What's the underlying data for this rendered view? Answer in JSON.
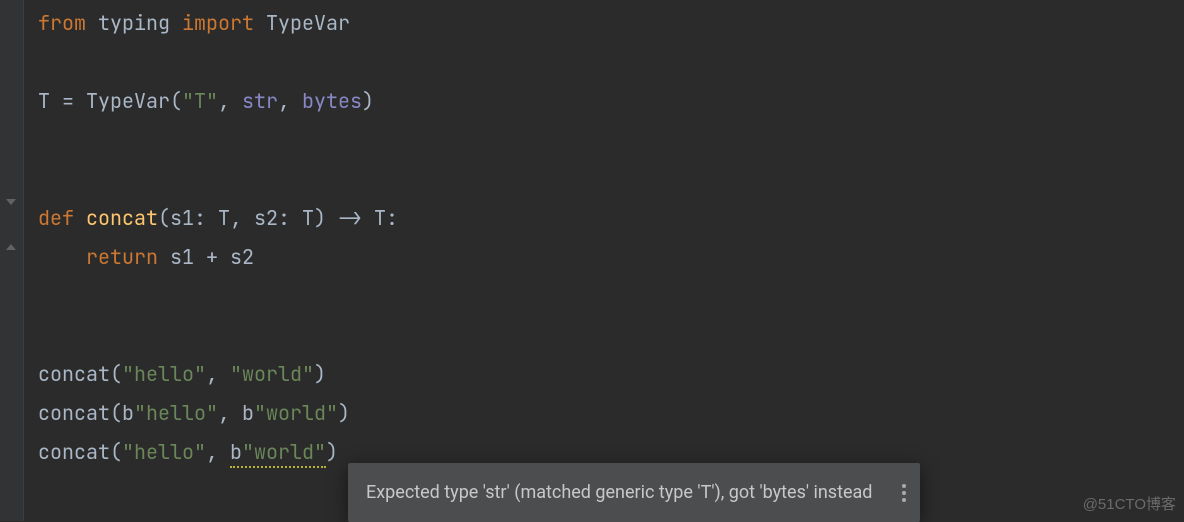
{
  "code": {
    "line1": {
      "kw1": "from",
      "mod": "typing",
      "kw2": "import",
      "name": "TypeVar"
    },
    "line3": {
      "var": "T",
      "eq": " = ",
      "ctor": "TypeVar",
      "lp": "(",
      "strT": "\"T\"",
      "c1": ", ",
      "a1": "str",
      "c2": ", ",
      "a2": "bytes",
      "rp": ")"
    },
    "line6": {
      "kw": "def",
      "fn": "concat",
      "lp": "(",
      "p1": "s1",
      "colon1": ": ",
      "t1": "T",
      "c": ", ",
      "p2": "s2",
      "colon2": ": ",
      "t2": "T",
      "rp": ")",
      "arrow": " -> ",
      "ret": "T",
      "end": ":"
    },
    "line7": {
      "indent": "    ",
      "kw": "return",
      "expr": " s1 + s2"
    },
    "line10": {
      "fn": "concat",
      "lp": "(",
      "s1": "\"hello\"",
      "c": ", ",
      "s2": "\"world\"",
      "rp": ")"
    },
    "line11": {
      "fn": "concat",
      "lp": "(",
      "pfx1": "b",
      "s1": "\"hello\"",
      "c": ", ",
      "pfx2": "b",
      "s2": "\"world\"",
      "rp": ")"
    },
    "line12": {
      "fn": "concat",
      "lp": "(",
      "s1": "\"hello\"",
      "c": ", ",
      "pfx2": "b",
      "s2": "\"world\"",
      "rp": ")"
    }
  },
  "tooltip": {
    "text": "Expected type 'str' (matched generic type 'T'), got 'bytes' instead"
  },
  "watermark": "@51CTO博客"
}
